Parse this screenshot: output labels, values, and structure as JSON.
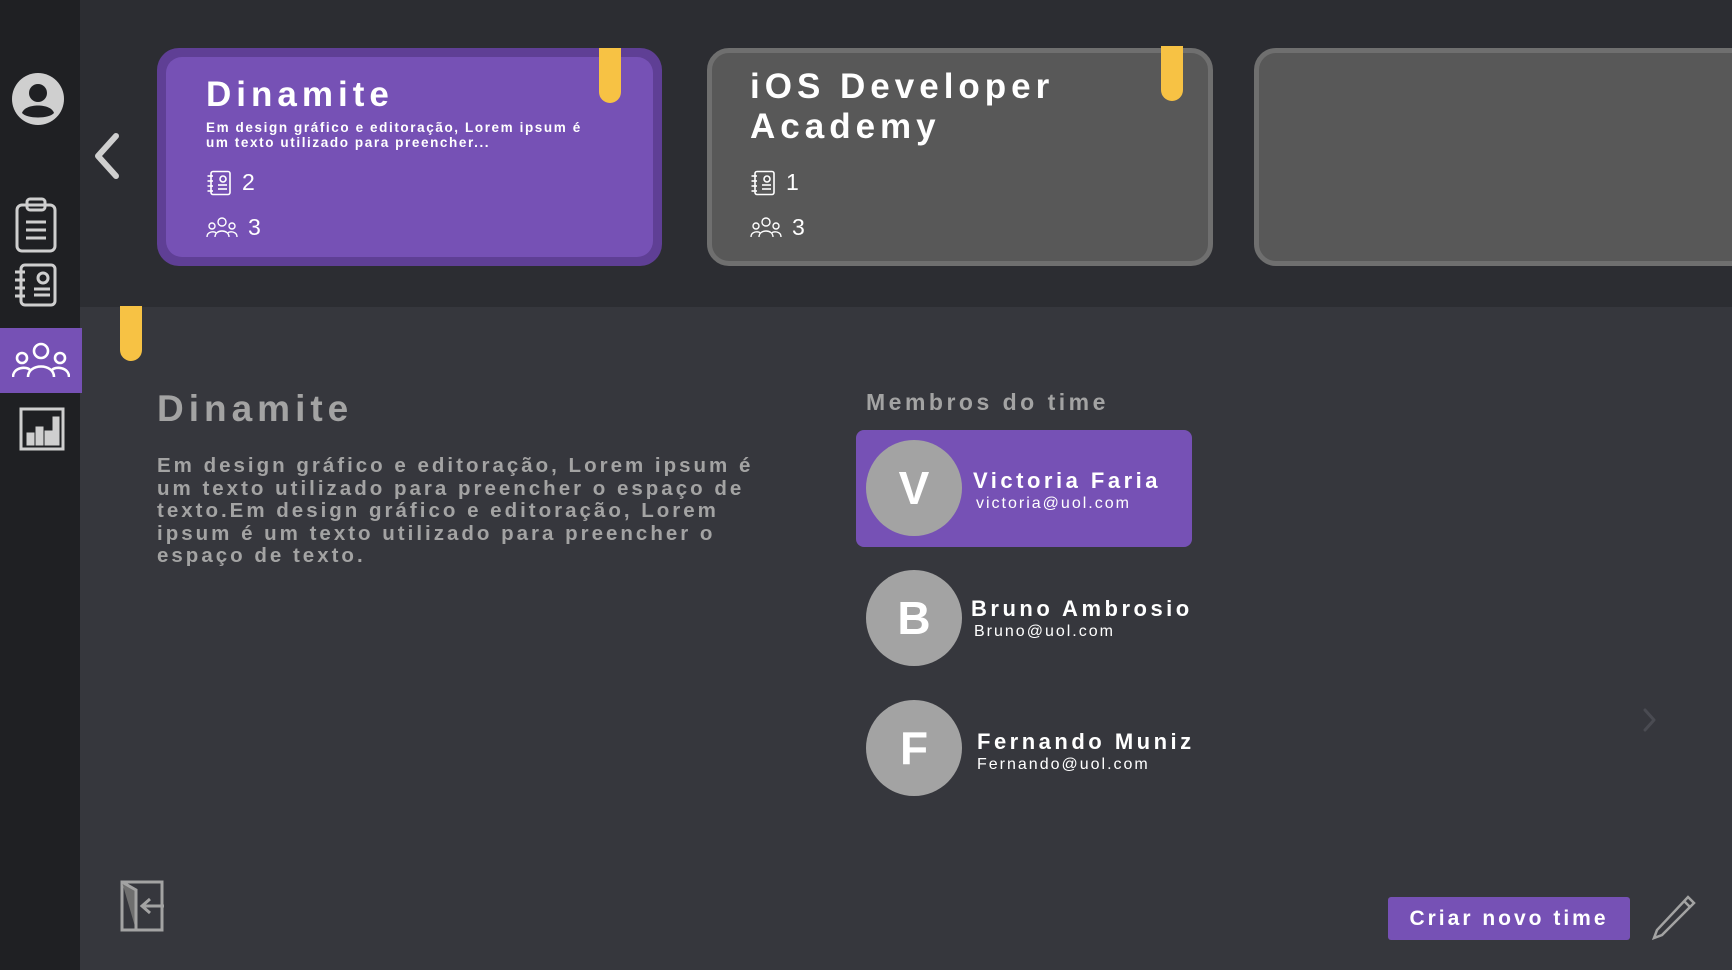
{
  "sidebar": {
    "icons": [
      "avatar-icon",
      "notebook-clip-icon",
      "notebook-icon",
      "team-icon",
      "chart-icon",
      "logout-icon"
    ],
    "active": "team-icon"
  },
  "cards": [
    {
      "title": "Dinamite",
      "description": "Em design gráfico e editoração, Lorem ipsum é um texto utilizado para preencher...",
      "projects": "2",
      "members": "3",
      "selected": true
    },
    {
      "title_line1": "iOS Developer",
      "title_line2": "Academy",
      "projects": "1",
      "members": "3",
      "selected": false
    }
  ],
  "detail": {
    "title": "Dinamite",
    "description": "Em design gráfico e editoração, Lorem ipsum é um texto utilizado para preencher o espaço de texto.Em design gráfico e editoração, Lorem ipsum é um texto utilizado para preencher o espaço de texto."
  },
  "members": {
    "title": "Membros do time",
    "items": [
      {
        "initial": "V",
        "name": "Victoria Faria",
        "email": "victoria@uol.com",
        "selected": true
      },
      {
        "initial": "B",
        "name": "Bruno Ambrosio",
        "email": "Bruno@uol.com",
        "selected": false
      },
      {
        "initial": "F",
        "name": "Fernando Muniz",
        "email": "Fernando@uol.com",
        "selected": false
      }
    ]
  },
  "actions": {
    "create_team": "Criar novo time"
  },
  "colors": {
    "accent": "#7651b5",
    "tab": "#f7c244",
    "background": "#36373d",
    "sidebar": "#1f2023",
    "muted_text": "#a3a3a3"
  }
}
